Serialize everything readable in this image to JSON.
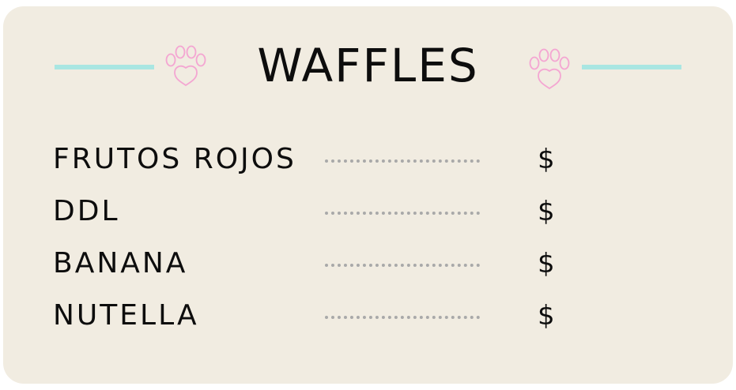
{
  "menu": {
    "title": "WAFFLES",
    "items": [
      {
        "name": "FRUTOS ROJOS",
        "price": "$"
      },
      {
        "name": "DDL",
        "price": "$"
      },
      {
        "name": "BANANA",
        "price": "$"
      },
      {
        "name": "NUTELLA",
        "price": "$"
      }
    ]
  },
  "decor": {
    "left_icon": "paw-icon",
    "right_icon": "paw-icon",
    "rule_color": "#a9e6e2",
    "paw_color": "#f4a6d2",
    "card_color": "#f1ece1",
    "dot_color": "#a9a9a9"
  }
}
